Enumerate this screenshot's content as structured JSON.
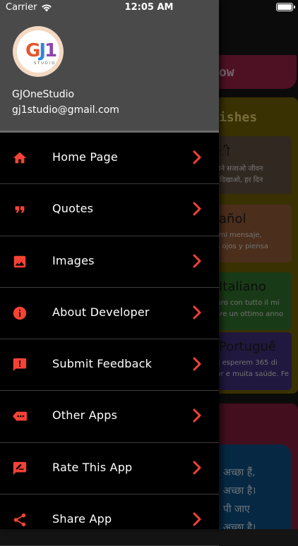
{
  "status_bar": {
    "carrier": "Carrier",
    "time": "12:05 AM"
  },
  "drawer": {
    "user_name": "GJOneStudio",
    "user_email": "gj1studio@gmail.com",
    "logo_text": "GJ1",
    "logo_sub": "STUDIO",
    "items": [
      {
        "label": "Home Page",
        "icon": "home-icon"
      },
      {
        "label": "Quotes",
        "icon": "quote-icon"
      },
      {
        "label": "Images",
        "icon": "image-icon"
      },
      {
        "label": "About Developer",
        "icon": "info-icon"
      },
      {
        "label": "Submit Feedback",
        "icon": "feedback-icon"
      },
      {
        "label": "Other Apps",
        "icon": "more-apps-icon"
      },
      {
        "label": "Rate This App",
        "icon": "rate-icon"
      },
      {
        "label": "Share App",
        "icon": "share-icon"
      }
    ]
  },
  "background": {
    "banner_text": "ow",
    "panel_title": "ishes",
    "cards": [
      {
        "title": "ी",
        "line1": "सपने सजाओ जीवन",
        "line2": "फ दिखाओ, हर दिन"
      },
      {
        "title": "añol",
        "line1": "e mi mensaje,",
        "line2": "os ojos y piensa"
      },
      {
        "title": "Italiano",
        "line1": "guro con tutto il mi",
        "line2": "sare un ottimo anno"
      },
      {
        "title": "Portuguê",
        "line1": "os esperem 365 di",
        "line2": "nor e muita saúde. Fe"
      }
    ],
    "bottom_lines": [
      "अच्छा हैं,",
      "अच्छा है।",
      "पी जाए",
      "अच्छा है।"
    ]
  },
  "colors": {
    "accent": "#f44336",
    "drawer_bg": "#000000",
    "header_bg": "#4a4a4a"
  }
}
